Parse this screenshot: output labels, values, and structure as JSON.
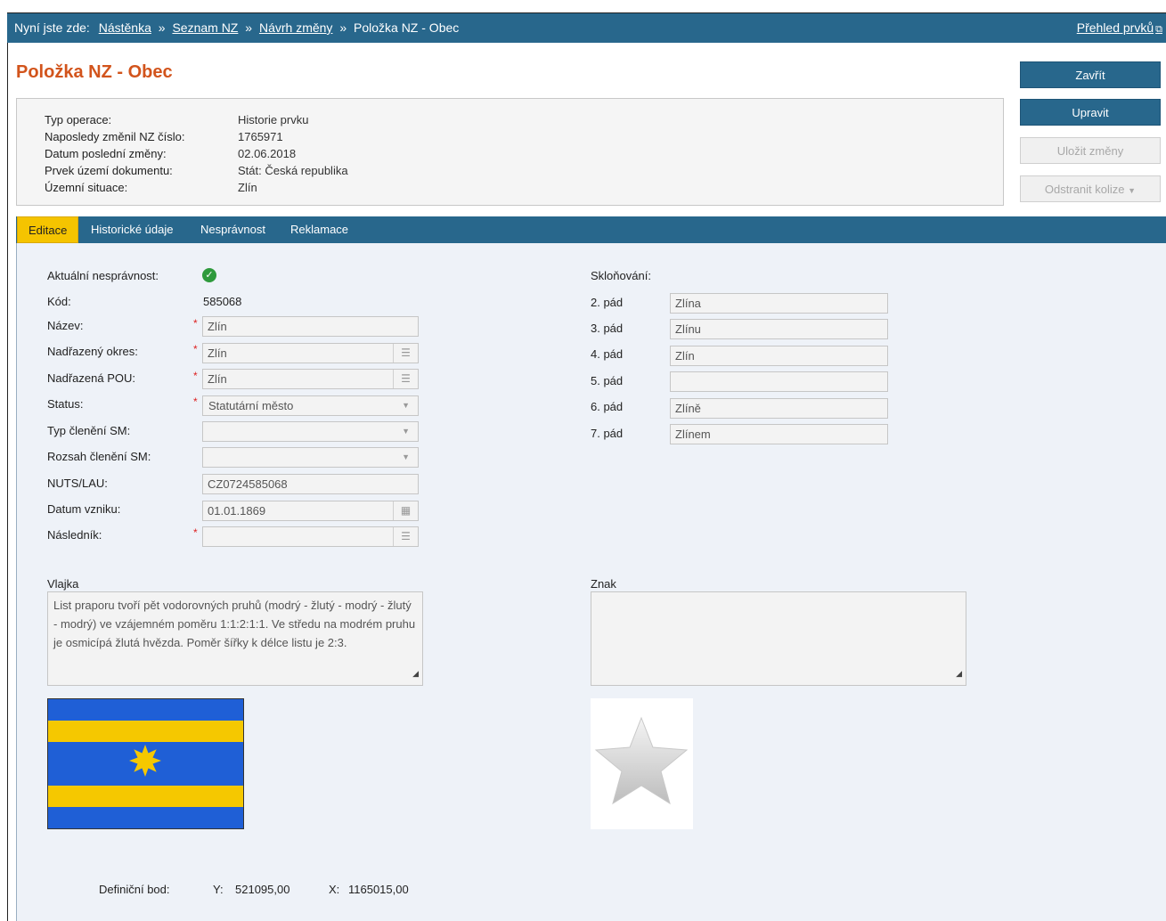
{
  "breadcrumb": {
    "prefix": "Nyní jste zde:",
    "items": [
      "Nástěnka",
      "Seznam NZ",
      "Návrh změny"
    ],
    "current": "Položka NZ - Obec",
    "separator": "»"
  },
  "overview_link": "Přehled prvků",
  "page_title": "Položka NZ - Obec",
  "buttons": {
    "close": "Zavřít",
    "edit": "Upravit",
    "save": "Uložit změny",
    "remove_conflicts": "Odstranit kolize"
  },
  "info": [
    {
      "label": "Typ operace:",
      "value": "Historie prvku"
    },
    {
      "label": "Naposledy změnil NZ číslo:",
      "value": "1765971"
    },
    {
      "label": "Datum poslední změny:",
      "value": "02.06.2018"
    },
    {
      "label": "Prvek území dokumentu:",
      "value": "Stát: Česká republika"
    },
    {
      "label": "Územní situace:",
      "value": "Zlín"
    }
  ],
  "tabs": [
    "Editace",
    "Historické údaje",
    "Nesprávnost",
    "Reklamace"
  ],
  "active_tab": "Editace",
  "form": {
    "current_incorrectness_label": "Aktuální nesprávnost:",
    "code_label": "Kód:",
    "code_value": "585068",
    "name_label": "Název:",
    "name_value": "Zlín",
    "district_label": "Nadřazený okres:",
    "district_value": "Zlín",
    "pou_label": "Nadřazená POU:",
    "pou_value": "Zlín",
    "status_label": "Status:",
    "status_value": "Statutární město",
    "sm_type_label": "Typ členění SM:",
    "sm_type_value": "",
    "sm_range_label": "Rozsah členění SM:",
    "sm_range_value": "",
    "nuts_label": "NUTS/LAU:",
    "nuts_value": "CZ0724585068",
    "founded_label": "Datum vzniku:",
    "founded_value": "01.01.1869",
    "successor_label": "Následník:",
    "successor_value": ""
  },
  "declension": {
    "title": "Skloňování:",
    "cases": [
      {
        "label": "2. pád",
        "value": "Zlína"
      },
      {
        "label": "3. pád",
        "value": "Zlínu"
      },
      {
        "label": "4. pád",
        "value": "Zlín"
      },
      {
        "label": "5. pád",
        "value": ""
      },
      {
        "label": "6. pád",
        "value": "Zlíně"
      },
      {
        "label": "7. pád",
        "value": "Zlínem"
      }
    ]
  },
  "flag": {
    "label": "Vlajka",
    "text": "List praporu tvoří pět vodorovných pruhů (modrý - žlutý - modrý - žlutý - modrý) ve vzájemném poměru 1:1:2:1:1. Ve středu na modrém pruhu je osmicípá žlutá hvězda. Poměr šířky k délce listu je 2:3.",
    "colors": {
      "blue": "#1f5fd6",
      "yellow": "#f5c800"
    }
  },
  "emblem": {
    "label": "Znak",
    "text": ""
  },
  "definition_point": {
    "label": "Definiční bod:",
    "y_label": "Y:",
    "y_value": "521095,00",
    "x_label": "X:",
    "x_value": "1165015,00"
  },
  "colors": {
    "header": "#28678c",
    "title": "#d2541c",
    "active_tab": "#f5c400",
    "content_bg": "#eef2f8"
  }
}
